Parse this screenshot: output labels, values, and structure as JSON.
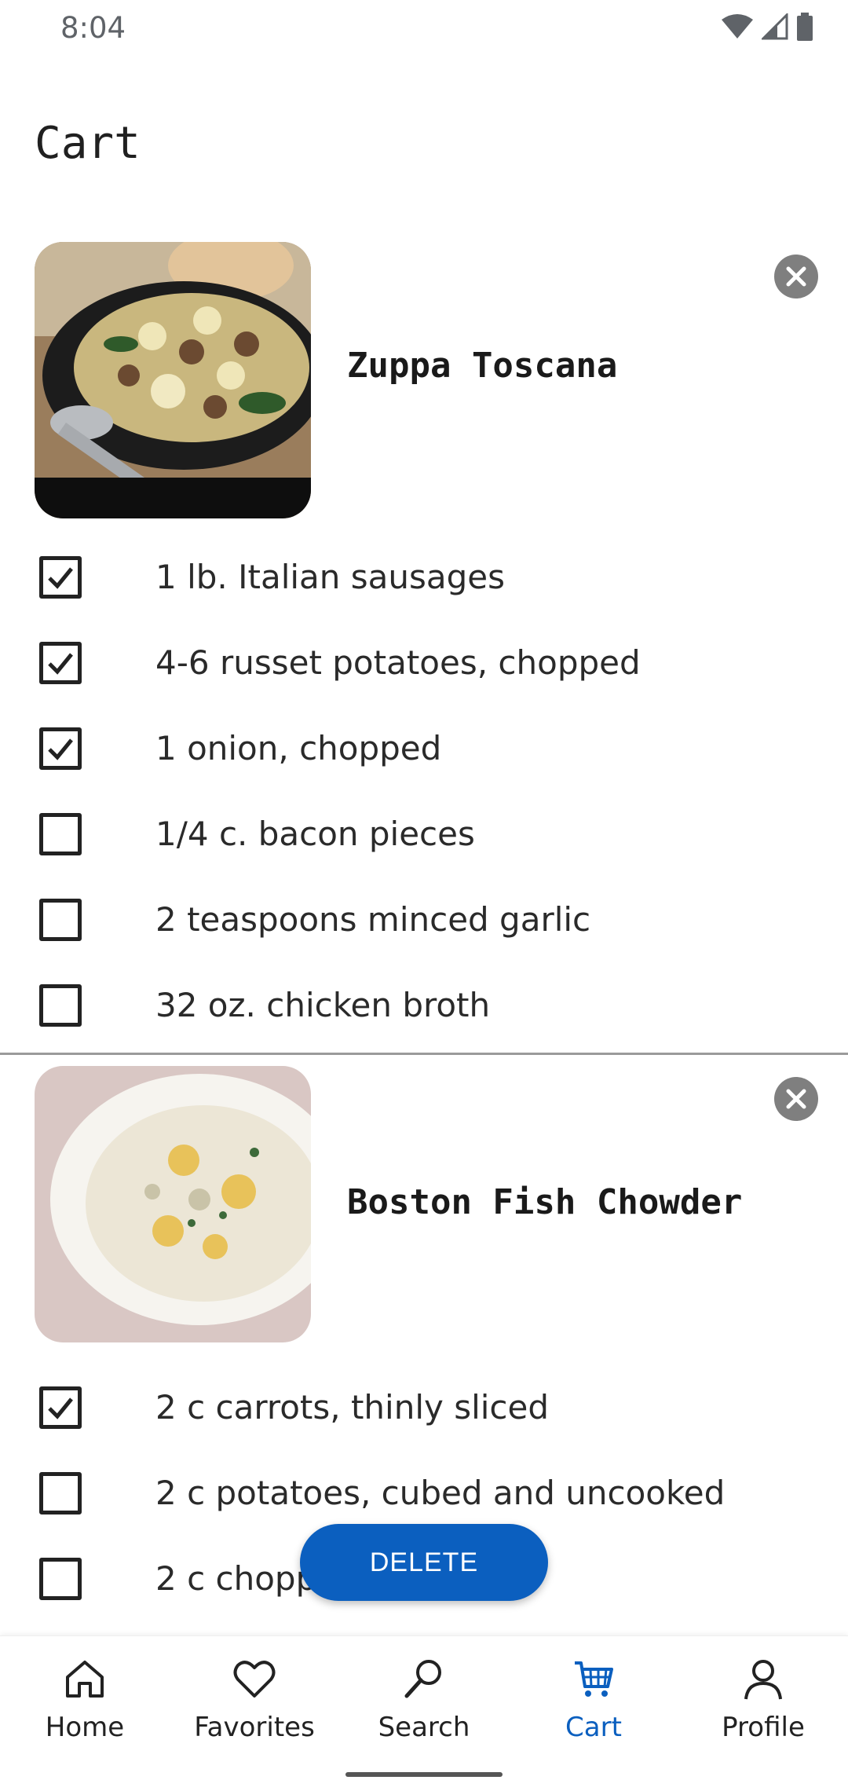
{
  "status": {
    "time": "8:04"
  },
  "page": {
    "title": "Cart"
  },
  "recipes": [
    {
      "title": "Zuppa Toscana",
      "ingredients": [
        {
          "label": "1 lb. Italian sausages",
          "checked": true
        },
        {
          "label": "4-6 russet potatoes, chopped",
          "checked": true
        },
        {
          "label": "1 onion, chopped",
          "checked": true
        },
        {
          "label": "1/4 c. bacon pieces",
          "checked": false
        },
        {
          "label": "2 teaspoons minced garlic",
          "checked": false
        },
        {
          "label": "32 oz. chicken broth",
          "checked": false
        }
      ]
    },
    {
      "title": "Boston Fish Chowder",
      "ingredients": [
        {
          "label": "2 c carrots, thinly sliced",
          "checked": true
        },
        {
          "label": "2 c potatoes, cubed and uncooked",
          "checked": false
        },
        {
          "label": "2 c chopp",
          "checked": false
        }
      ]
    }
  ],
  "fab": {
    "label": "DELETE"
  },
  "nav": {
    "items": [
      {
        "label": "Home",
        "icon": "home-icon",
        "active": false
      },
      {
        "label": "Favorites",
        "icon": "heart-icon",
        "active": false
      },
      {
        "label": "Search",
        "icon": "search-icon",
        "active": false
      },
      {
        "label": "Cart",
        "icon": "cart-icon",
        "active": true
      },
      {
        "label": "Profile",
        "icon": "profile-icon",
        "active": false
      }
    ]
  },
  "colors": {
    "accent": "#0b5fbf",
    "close_button": "#7f7f7f",
    "text": "#222222"
  }
}
